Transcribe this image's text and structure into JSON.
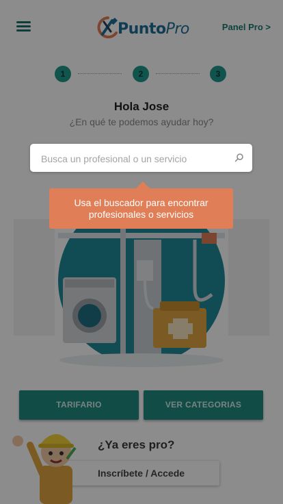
{
  "header": {
    "menu_icon": "hamburger-menu-icon",
    "logo": {
      "part1": "Punto",
      "part2": "Pro",
      "icon": "tools-logo-icon"
    },
    "panel_pro_label": "Panel Pro >"
  },
  "steps": [
    "1",
    "2",
    "3"
  ],
  "greeting": "Hola Jose",
  "subtitle": "¿En qué te podemos ayudar hoy?",
  "search": {
    "placeholder": "Busca un profesional o un servicio",
    "icon": "search-icon"
  },
  "tooltip": {
    "line1": "Usa el buscador para encontrar",
    "line2": "profesionales o servicios"
  },
  "buttons": {
    "tarifario": "TARIFARIO",
    "categorias": "VER CATEGORIAS"
  },
  "pro_section": {
    "question": "¿Ya eres pro?",
    "cta": "Inscríbete / Accede"
  },
  "colors": {
    "teal": "#1f8a80",
    "orange": "#e07e57",
    "logo_blue": "#1f6f9a"
  }
}
